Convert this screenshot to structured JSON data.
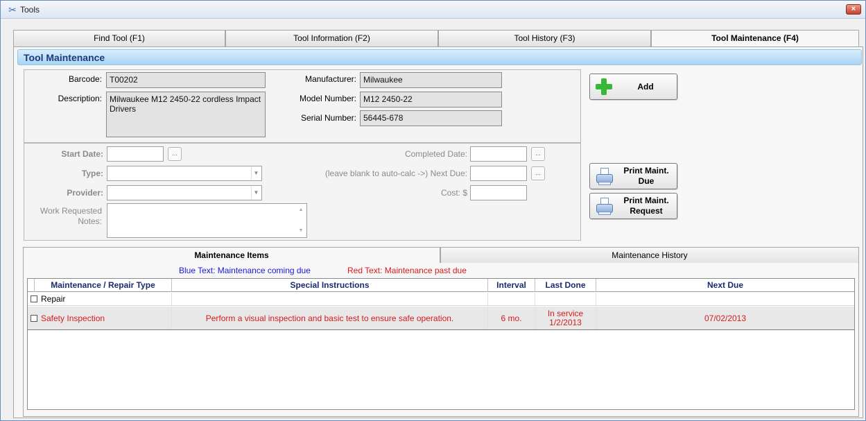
{
  "window": {
    "title": "Tools",
    "close_label": "×"
  },
  "tabs": [
    {
      "label": "Find Tool (F1)"
    },
    {
      "label": "Tool Information (F2)"
    },
    {
      "label": "Tool History (F3)"
    },
    {
      "label": "Tool Maintenance (F4)"
    }
  ],
  "section_title": "Tool Maintenance",
  "tool": {
    "barcode_label": "Barcode:",
    "barcode": "T00202",
    "description_label": "Description:",
    "description": "Milwaukee M12 2450-22 cordless Impact Drivers",
    "manufacturer_label": "Manufacturer:",
    "manufacturer": "Milwaukee",
    "model_label": "Model Number:",
    "model": "M12 2450-22",
    "serial_label": "Serial Number:",
    "serial": "56445-678"
  },
  "form": {
    "start_date_label": "Start Date:",
    "start_date": "",
    "type_label": "Type:",
    "type": "",
    "provider_label": "Provider:",
    "provider": "",
    "work_requested_label": "Work Requested",
    "notes_label": "Notes:",
    "notes": "",
    "completed_date_label": "Completed Date:",
    "completed_date": "",
    "next_due_label": "(leave blank to auto-calc ->)  Next Due:",
    "next_due": "",
    "cost_label": "Cost: $",
    "cost": "",
    "ellipsis": "..."
  },
  "buttons": {
    "add": "Add",
    "print_due_line1": "Print Maint.",
    "print_due_line2": "Due",
    "print_request_line1": "Print Maint.",
    "print_request_line2": "Request"
  },
  "subtabs": [
    {
      "label": "Maintenance Items"
    },
    {
      "label": "Maintenance History"
    }
  ],
  "legend": {
    "blue": "Blue Text:  Maintenance coming due",
    "red": "Red Text:  Maintenance past due"
  },
  "colors": {
    "due_soon": "#1a1ad8",
    "past_due": "#d81a1a",
    "header_accent": "#1a3b7a"
  },
  "table": {
    "columns": [
      "Maintenance / Repair Type",
      "Special Instructions",
      "Interval",
      "Last Done",
      "Next Due"
    ],
    "rows": [
      {
        "type": "Repair",
        "instructions": "",
        "interval": "",
        "last_done_1": "",
        "last_done_2": "",
        "next_due": "",
        "status": "normal"
      },
      {
        "type": "Safety Inspection",
        "instructions": "Perform a visual inspection and basic test to ensure safe operation.",
        "interval": "6 mo.",
        "last_done_1": "In service",
        "last_done_2": "1/2/2013",
        "next_due": "07/02/2013",
        "status": "past_due"
      }
    ]
  }
}
